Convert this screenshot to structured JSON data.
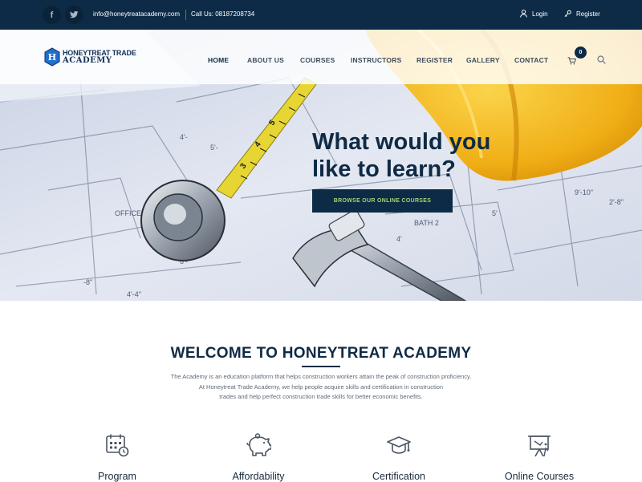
{
  "topbar": {
    "social": [
      {
        "name": "facebook-icon",
        "glyph": "f"
      },
      {
        "name": "twitter-icon",
        "glyph": "t"
      }
    ],
    "email": "info@honeytreatacademy.com",
    "phone": "Call Us: 08187208734",
    "login": "Login",
    "register": "Register"
  },
  "logo": {
    "line1": "HONEYTREAT TRADE",
    "line2": "ACADEMY"
  },
  "nav": {
    "items": [
      "HOME",
      "ABOUT US",
      "COURSES",
      "INSTRUCTORS",
      "REGISTER",
      "GALLERY",
      "CONTACT"
    ],
    "active": "HOME",
    "cart_count": "0"
  },
  "hero": {
    "headline_line1": "What would you",
    "headline_line2": "like to learn?",
    "cta_label": "BROWSE OUR ONLINE COURSES",
    "slides": 3,
    "active_slide": 1
  },
  "welcome": {
    "title": "WELCOME TO HONEYTREAT ACADEMY",
    "desc_line1": "The Academy is an education platform that helps construction workers attain the peak of construction proficiency.",
    "desc_line2": "At Honeytreat Trade Academy, we help people acquire skills and certification in construction",
    "desc_line3": "trades and help perfect construction trade skills for better economic benefits."
  },
  "features": [
    {
      "label": "Program",
      "icon": "calendar-icon"
    },
    {
      "label": "Affordability",
      "icon": "piggy-bank-icon"
    },
    {
      "label": "Certification",
      "icon": "graduation-cap-icon"
    },
    {
      "label": "Online Courses",
      "icon": "presentation-board-icon"
    }
  ],
  "colors": {
    "navy": "#0d2b46",
    "cta_text": "#9fd66f",
    "hardhat": "#f3b51e",
    "tape": "#e8d83a"
  }
}
